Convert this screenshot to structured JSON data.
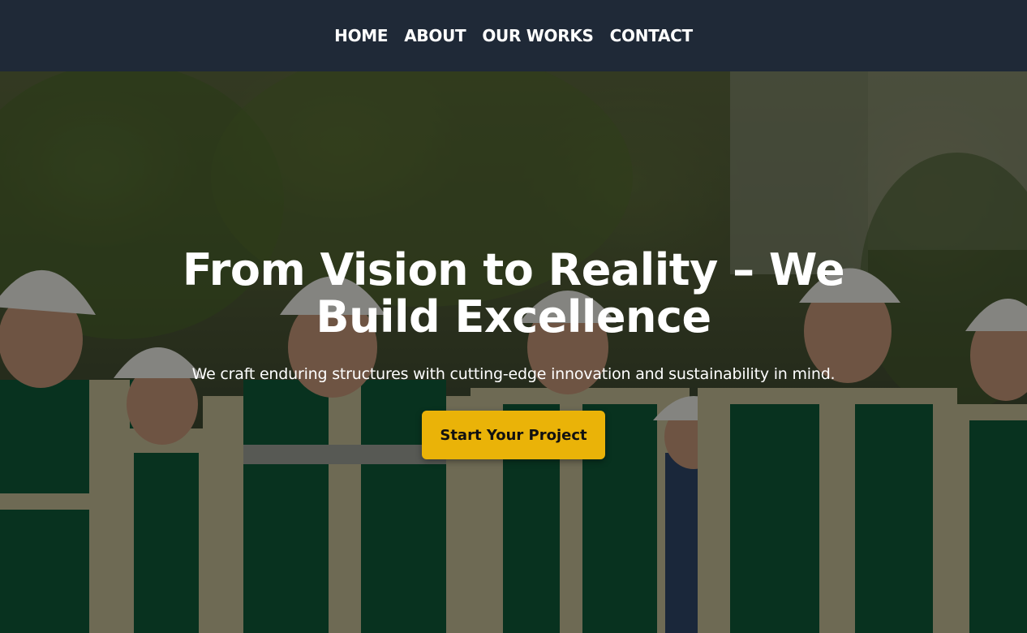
{
  "nav": {
    "items": [
      {
        "label": "HOME"
      },
      {
        "label": "ABOUT"
      },
      {
        "label": "OUR WORKS"
      },
      {
        "label": "CONTACT"
      }
    ]
  },
  "hero": {
    "title": "From Vision to Reality – We Build Excellence",
    "subtitle": "We craft enduring structures with cutting-edge innovation and sustainability in mind.",
    "cta_label": "Start Your Project"
  },
  "colors": {
    "nav_background": "#1f2937",
    "cta_background": "#eab308",
    "text": "#ffffff",
    "uniform_green": "#0f5b3a",
    "uniform_beige": "#c9c19a"
  }
}
